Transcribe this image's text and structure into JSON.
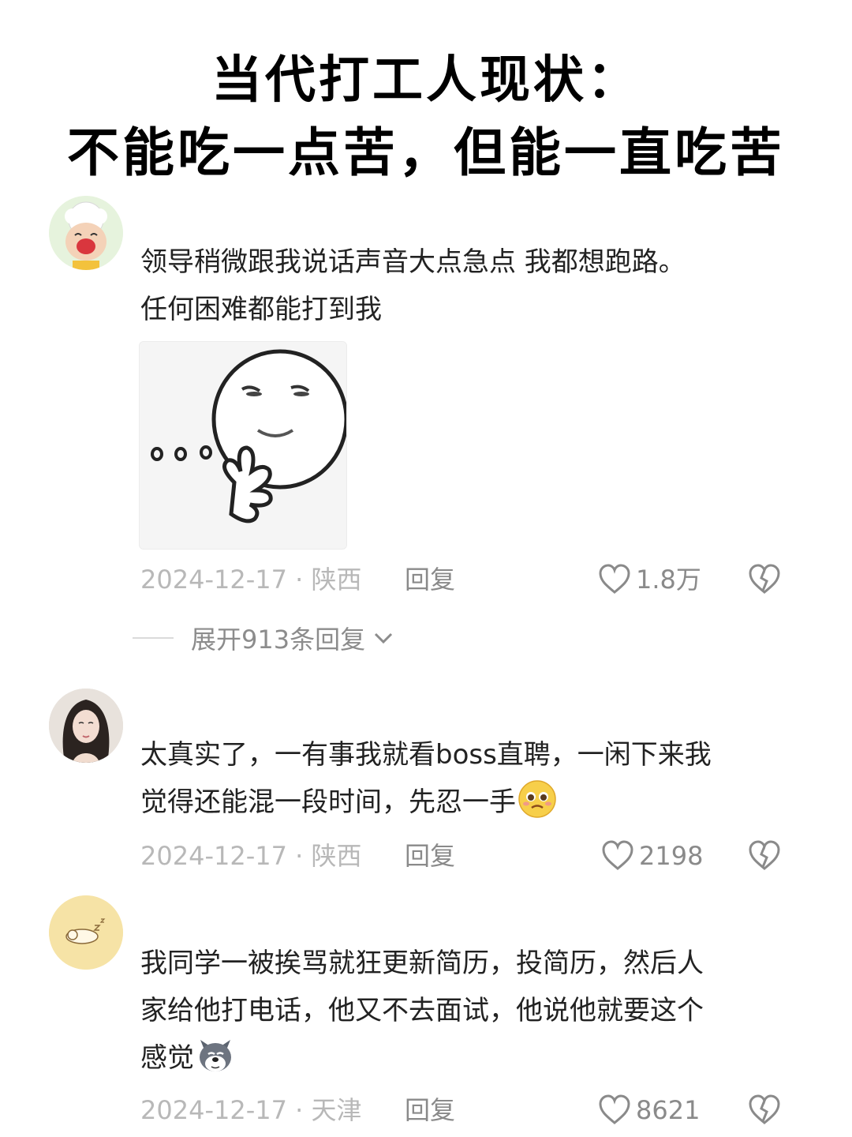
{
  "headline": {
    "line1": "当代打工人现状：",
    "line2": "不能吃一点苦，但能一直吃苦"
  },
  "comments": [
    {
      "text_line1": "领导稍微跟我说话声音大点急点 我都想跑路。",
      "text_line2": "任何困难都能打到我",
      "date": "2024-12-17",
      "location": "陕西",
      "reply_label": "回复",
      "likes": "1.8万",
      "avatar_icon": "crying-sheep-avatar",
      "sticker_icon": "thinking-face-sticker"
    },
    {
      "text_line1": "太真实了，一有事我就看boss直聘，一闲下来我",
      "text_line2": "觉得还能混一段时间，先忍一手",
      "emoji": "pleading-face-emoji",
      "date": "2024-12-17",
      "location": "陕西",
      "reply_label": "回复",
      "likes": "2198",
      "avatar_icon": "woman-portrait-avatar"
    },
    {
      "text_line1": "我同学一被挨骂就狂更新简历，投简历，然后人",
      "text_line2": "家给他打电话，他又不去面试，他说他就要这个",
      "text_line3": "感觉",
      "emoji": "dog-face-emoji",
      "date": "2024-12-17",
      "location": "天津",
      "reply_label": "回复",
      "likes": "8621",
      "avatar_icon": "sleeping-animal-avatar"
    }
  ],
  "expand_replies": "展开913条回复",
  "colors": {
    "meta_gray": "#b8b8b8",
    "action_gray": "#8a8a8a",
    "text": "#222222"
  }
}
